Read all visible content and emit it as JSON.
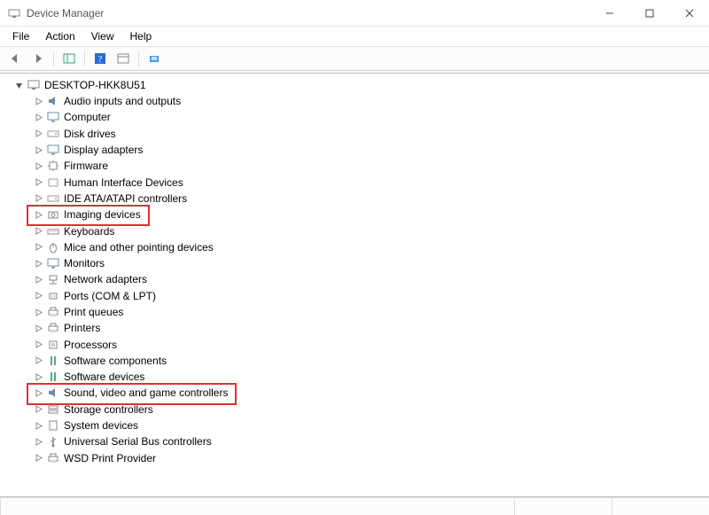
{
  "window": {
    "title": "Device Manager"
  },
  "menus": {
    "file": "File",
    "action": "Action",
    "view": "View",
    "help": "Help"
  },
  "tree": {
    "root_label": "DESKTOP-HKK8U51",
    "items": [
      {
        "label": "Audio inputs and outputs",
        "icon": "speaker-icon",
        "highlighted": false
      },
      {
        "label": "Computer",
        "icon": "monitor-icon",
        "highlighted": false
      },
      {
        "label": "Disk drives",
        "icon": "drive-icon",
        "highlighted": false
      },
      {
        "label": "Display adapters",
        "icon": "monitor-icon",
        "highlighted": false
      },
      {
        "label": "Firmware",
        "icon": "chip-icon",
        "highlighted": false
      },
      {
        "label": "Human Interface Devices",
        "icon": "hid-icon",
        "highlighted": false
      },
      {
        "label": "IDE ATA/ATAPI controllers",
        "icon": "drive-icon",
        "highlighted": false
      },
      {
        "label": "Imaging devices",
        "icon": "camera-icon",
        "highlighted": true
      },
      {
        "label": "Keyboards",
        "icon": "keyboard-icon",
        "highlighted": false
      },
      {
        "label": "Mice and other pointing devices",
        "icon": "mouse-icon",
        "highlighted": false
      },
      {
        "label": "Monitors",
        "icon": "monitor-icon",
        "highlighted": false
      },
      {
        "label": "Network adapters",
        "icon": "network-icon",
        "highlighted": false
      },
      {
        "label": "Ports (COM & LPT)",
        "icon": "port-icon",
        "highlighted": false
      },
      {
        "label": "Print queues",
        "icon": "printer-icon",
        "highlighted": false
      },
      {
        "label": "Printers",
        "icon": "printer-icon",
        "highlighted": false
      },
      {
        "label": "Processors",
        "icon": "cpu-icon",
        "highlighted": false
      },
      {
        "label": "Software components",
        "icon": "component-icon",
        "highlighted": false
      },
      {
        "label": "Software devices",
        "icon": "component-icon",
        "highlighted": false
      },
      {
        "label": "Sound, video and game controllers",
        "icon": "speaker-icon",
        "highlighted": true
      },
      {
        "label": "Storage controllers",
        "icon": "storage-icon",
        "highlighted": false
      },
      {
        "label": "System devices",
        "icon": "system-icon",
        "highlighted": false
      },
      {
        "label": "Universal Serial Bus controllers",
        "icon": "usb-icon",
        "highlighted": false
      },
      {
        "label": "WSD Print Provider",
        "icon": "printer-icon",
        "highlighted": false
      }
    ]
  }
}
